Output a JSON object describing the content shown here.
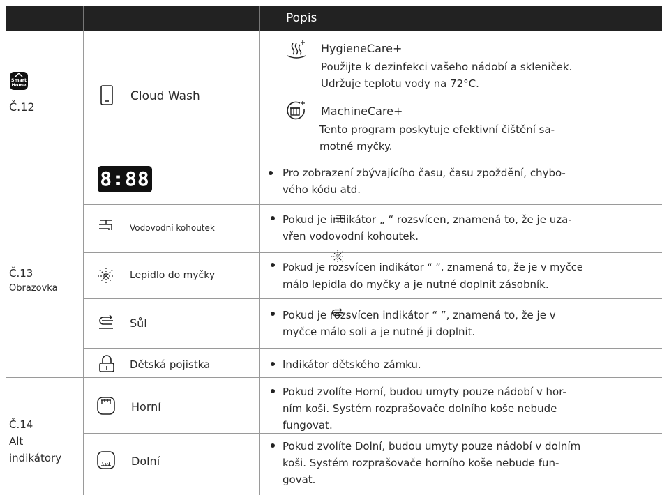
{
  "header": {
    "title": "Popis"
  },
  "row_c12": {
    "label": "Č.12",
    "smart_home": "Smart Home",
    "cloud_wash": "Cloud Wash",
    "hygiene_title": "HygieneCare+",
    "hygiene_line1": "Použijte k dezinfekci vašeho nádobí a skleniček.",
    "hygiene_line2": "Udržuje teplotu vody na 72°C.",
    "machine_title": "MachineCare+",
    "machine_line1": "Tento program poskytuje efektivní čištění sa-",
    "machine_line2": "motné myčky."
  },
  "row_c13": {
    "label": "Č.13",
    "sublabel": "Obrazovka",
    "display_digits": "8:88",
    "display_line1": "Pro zobrazení zbývajícího času, času zpoždění, chybo-",
    "display_line2": "vého kódu atd.",
    "tap_label": "Vodovodní kohoutek",
    "tap_line1": "Pokud je indikátor „ “ rozsvícen, znamená to, že je uza-",
    "tap_line2": "vřen vodovodní kohoutek.",
    "glue_label": "Lepidlo do myčky",
    "glue_line1": "Pokud je rozsvícen indikátor “ ”, znamená to, že je v myčce",
    "glue_line2": "málo lepidla do myčky a je nutné doplnit zásobník.",
    "salt_label": "Sůl",
    "salt_line1": "Pokud je rozsvícen indikátor “ ”, znamená to, že je v",
    "salt_line2": "myčce málo soli a je nutné ji doplnit.",
    "lock_label": "Dětská pojistka",
    "lock_line1": "Indikátor dětského zámku."
  },
  "row_c14": {
    "label": "Č.14",
    "label2": "Alt",
    "label3": "indikátory",
    "upper_label": "Horní",
    "upper_line1": "Pokud zvolíte Horní, budou umyty pouze nádobí v hor-",
    "upper_line2": "ním koši. Systém rozprašovače dolního koše nebude",
    "upper_line3": "fungovat.",
    "lower_label": "Dolní",
    "lower_line1": "Pokud zvolíte Dolní, budou umyty pouze nádobí v dolním",
    "lower_line2": "koši. Systém rozprašovače horního koše nebude fun-",
    "lower_line3": "govat."
  },
  "icons": [
    "smart-home-icon",
    "phone-icon",
    "steam-icon",
    "machine-care-icon",
    "tap-icon",
    "glue-icon",
    "salt-icon",
    "lock-icon",
    "upper-basket-icon",
    "lower-basket-icon"
  ]
}
